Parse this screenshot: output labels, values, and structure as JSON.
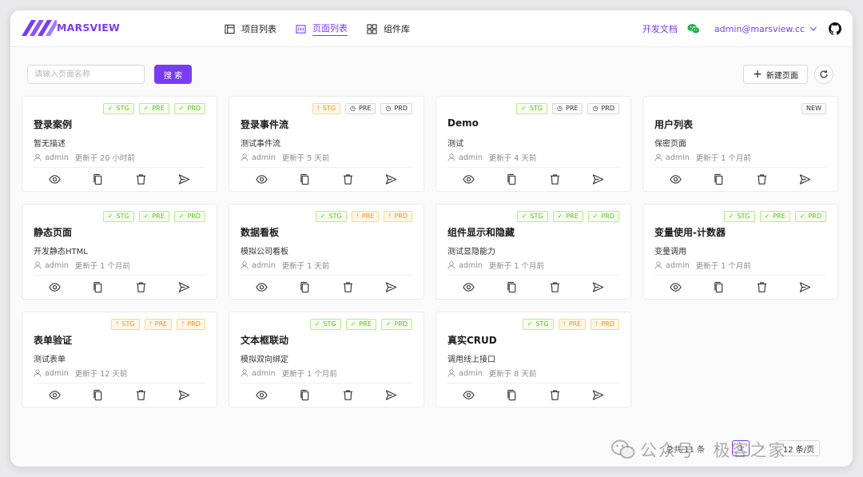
{
  "app": {
    "logo_text": "MARSVIEW"
  },
  "nav": [
    {
      "label": "项目列表",
      "icon": "project-list-icon",
      "active": false
    },
    {
      "label": "页面列表",
      "icon": "page-list-icon",
      "active": true
    },
    {
      "label": "组件库",
      "icon": "component-grid-icon",
      "active": false
    }
  ],
  "header": {
    "docs": "开发文档",
    "user": "admin@marsview.cc"
  },
  "toolbar": {
    "search_placeholder": "请输入页面名称",
    "search_label": "搜 索",
    "new_page_label": "新建页面"
  },
  "colors": {
    "accent": "#7a3cf0",
    "green": "#52c41a",
    "orange": "#fa8c16"
  },
  "cards": [
    {
      "title": "登录案例",
      "desc": "暂无描述",
      "user": "admin",
      "updated": "更新于 20 小时前",
      "badges": [
        {
          "label": "STG",
          "status": "green"
        },
        {
          "label": "PRE",
          "status": "green"
        },
        {
          "label": "PRD",
          "status": "green"
        }
      ]
    },
    {
      "title": "登录事件流",
      "desc": "测试事件流",
      "user": "admin",
      "updated": "更新于 5 天前",
      "badges": [
        {
          "label": "STG",
          "status": "orange"
        },
        {
          "label": "PRE",
          "status": "gray"
        },
        {
          "label": "PRD",
          "status": "gray"
        }
      ]
    },
    {
      "title": "Demo",
      "desc": "测试",
      "user": "admin",
      "updated": "更新于 4 天前",
      "badges": [
        {
          "label": "STG",
          "status": "green"
        },
        {
          "label": "PRE",
          "status": "gray"
        },
        {
          "label": "PRD",
          "status": "gray"
        }
      ]
    },
    {
      "title": "用户列表",
      "desc": "保密页面",
      "user": "admin",
      "updated": "更新于 1 个月前",
      "badges": [
        {
          "label": "NEW",
          "status": "new"
        }
      ]
    },
    {
      "title": "静态页面",
      "desc": "开发静态HTML",
      "user": "admin",
      "updated": "更新于 1 个月前",
      "badges": [
        {
          "label": "STG",
          "status": "green"
        },
        {
          "label": "PRE",
          "status": "green"
        },
        {
          "label": "PRD",
          "status": "green"
        }
      ]
    },
    {
      "title": "数据看板",
      "desc": "模拟公司看板",
      "user": "admin",
      "updated": "更新于 1 天前",
      "badges": [
        {
          "label": "STG",
          "status": "green"
        },
        {
          "label": "PRE",
          "status": "orange"
        },
        {
          "label": "PRD",
          "status": "orange"
        }
      ]
    },
    {
      "title": "组件显示和隐藏",
      "desc": "测试显隐能力",
      "user": "admin",
      "updated": "更新于 1 个月前",
      "badges": [
        {
          "label": "STG",
          "status": "green"
        },
        {
          "label": "PRE",
          "status": "green"
        },
        {
          "label": "PRD",
          "status": "green"
        }
      ]
    },
    {
      "title": "变量使用-计数器",
      "desc": "变量调用",
      "user": "admin",
      "updated": "更新于 1 个月前",
      "badges": [
        {
          "label": "STG",
          "status": "green"
        },
        {
          "label": "PRE",
          "status": "green"
        },
        {
          "label": "PRD",
          "status": "green"
        }
      ]
    },
    {
      "title": "表单验证",
      "desc": "测试表单",
      "user": "admin",
      "updated": "更新于 12 天前",
      "badges": [
        {
          "label": "STG",
          "status": "orange"
        },
        {
          "label": "PRE",
          "status": "orange"
        },
        {
          "label": "PRD",
          "status": "orange"
        }
      ]
    },
    {
      "title": "文本框联动",
      "desc": "模拟双向绑定",
      "user": "admin",
      "updated": "更新于 1 个月前",
      "badges": [
        {
          "label": "STG",
          "status": "green"
        },
        {
          "label": "PRE",
          "status": "green"
        },
        {
          "label": "PRD",
          "status": "green"
        }
      ]
    },
    {
      "title": "真实CRUD",
      "desc": "调用线上接口",
      "user": "admin",
      "updated": "更新于 8 天前",
      "badges": [
        {
          "label": "STG",
          "status": "green"
        },
        {
          "label": "PRE",
          "status": "orange"
        },
        {
          "label": "PRD",
          "status": "orange"
        }
      ]
    }
  ],
  "pagination": {
    "total": "总共 11 条",
    "current": "1",
    "page_size": "12 条/页"
  },
  "watermark": {
    "left": "公众号",
    "right": "极客之家"
  }
}
